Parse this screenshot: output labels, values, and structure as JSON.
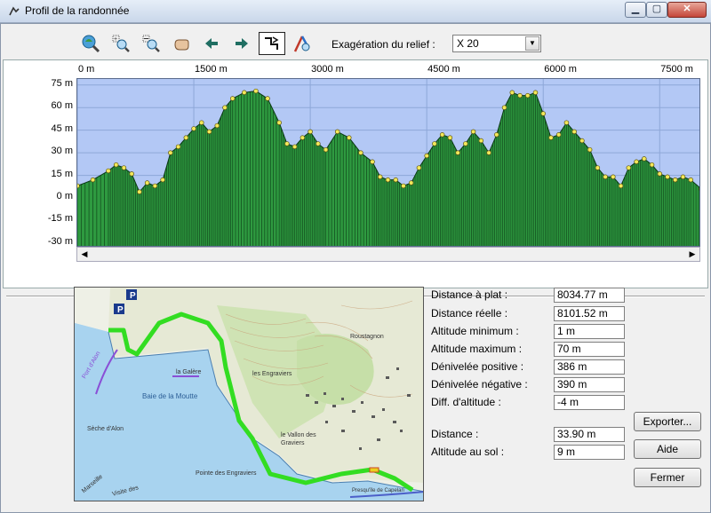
{
  "window": {
    "title": "Profil de la randonnée",
    "controls": {
      "minimize": "▁",
      "maximize": "▢",
      "close": "✕"
    }
  },
  "toolbar": {
    "icons": [
      "zoom-extent-icon",
      "zoom-in-icon",
      "zoom-out-icon",
      "pan-hand-icon",
      "arrow-left-icon",
      "arrow-right-icon",
      "profile-mode-icon",
      "measure-icon"
    ],
    "exaggeration_label": "Exagération du relief :",
    "exaggeration_value": "X 20"
  },
  "chart_data": {
    "type": "area",
    "x_tick_labels": [
      "0 m",
      "1500 m",
      "3000 m",
      "4500 m",
      "6000 m",
      "7500 m"
    ],
    "x_ticks": [
      0,
      1500,
      3000,
      4500,
      6000,
      7500
    ],
    "y_tick_labels": [
      "75 m",
      "60 m",
      "45 m",
      "30 m",
      "15 m",
      "0 m",
      "-15 m",
      "-30 m"
    ],
    "y_ticks": [
      75,
      60,
      45,
      30,
      15,
      0,
      -15,
      -30
    ],
    "xlim": [
      0,
      8034.77
    ],
    "ylim": [
      -33,
      79
    ],
    "grid": true,
    "series": [
      {
        "points": [
          [
            0,
            8
          ],
          [
            200,
            12
          ],
          [
            400,
            18
          ],
          [
            500,
            22
          ],
          [
            600,
            20
          ],
          [
            700,
            16
          ],
          [
            800,
            4
          ],
          [
            900,
            10
          ],
          [
            1000,
            8
          ],
          [
            1100,
            12
          ],
          [
            1200,
            30
          ],
          [
            1300,
            34
          ],
          [
            1400,
            40
          ],
          [
            1500,
            46
          ],
          [
            1600,
            50
          ],
          [
            1700,
            44
          ],
          [
            1800,
            48
          ],
          [
            1900,
            60
          ],
          [
            2000,
            66
          ],
          [
            2150,
            70
          ],
          [
            2300,
            71
          ],
          [
            2450,
            66
          ],
          [
            2600,
            50
          ],
          [
            2700,
            36
          ],
          [
            2800,
            34
          ],
          [
            2900,
            40
          ],
          [
            3000,
            44
          ],
          [
            3100,
            36
          ],
          [
            3200,
            32
          ],
          [
            3350,
            44
          ],
          [
            3500,
            40
          ],
          [
            3650,
            30
          ],
          [
            3800,
            24
          ],
          [
            3900,
            14
          ],
          [
            4000,
            12
          ],
          [
            4100,
            12
          ],
          [
            4200,
            8
          ],
          [
            4300,
            10
          ],
          [
            4400,
            20
          ],
          [
            4500,
            28
          ],
          [
            4600,
            36
          ],
          [
            4700,
            42
          ],
          [
            4800,
            40
          ],
          [
            4900,
            30
          ],
          [
            5000,
            36
          ],
          [
            5100,
            44
          ],
          [
            5200,
            38
          ],
          [
            5300,
            30
          ],
          [
            5400,
            42
          ],
          [
            5500,
            60
          ],
          [
            5600,
            70
          ],
          [
            5700,
            68
          ],
          [
            5800,
            68
          ],
          [
            5900,
            70
          ],
          [
            6000,
            56
          ],
          [
            6100,
            40
          ],
          [
            6200,
            42
          ],
          [
            6300,
            50
          ],
          [
            6400,
            44
          ],
          [
            6500,
            38
          ],
          [
            6600,
            32
          ],
          [
            6700,
            20
          ],
          [
            6800,
            14
          ],
          [
            6900,
            14
          ],
          [
            7000,
            8
          ],
          [
            7100,
            20
          ],
          [
            7200,
            24
          ],
          [
            7300,
            26
          ],
          [
            7400,
            22
          ],
          [
            7500,
            16
          ],
          [
            7600,
            14
          ],
          [
            7700,
            12
          ],
          [
            7800,
            14
          ],
          [
            7900,
            12
          ],
          [
            8034.77,
            6
          ]
        ]
      }
    ]
  },
  "map": {
    "labels": [
      "Baie de la Moutte",
      "Sèche d'Alon",
      "Pointe des Engraviers",
      "le Vallon des Graviers",
      "Presqu'île de Capelan",
      "les Engraviers",
      "la Galère",
      "Port d'Alon",
      "Visite des",
      "Marseille",
      "Roustagnon",
      "P",
      "P"
    ]
  },
  "stats": [
    {
      "label": "Distance à plat :",
      "value": "8034.77 m"
    },
    {
      "label": "Distance réelle :",
      "value": "8101.52 m"
    },
    {
      "label": "Altitude minimum :",
      "value": "1 m"
    },
    {
      "label": "Altitude maximum :",
      "value": "70 m"
    },
    {
      "label": "Dénivelée positive :",
      "value": "386 m"
    },
    {
      "label": "Dénivelée négative :",
      "value": "390 m"
    },
    {
      "label": "Diff. d'altitude :",
      "value": "-4 m"
    }
  ],
  "cursor_stats": [
    {
      "label": "Distance :",
      "value": "33.90 m"
    },
    {
      "label": "Altitude au sol :",
      "value": "9 m"
    }
  ],
  "buttons": {
    "export": "Exporter...",
    "help": "Aide",
    "close": "Fermer"
  }
}
